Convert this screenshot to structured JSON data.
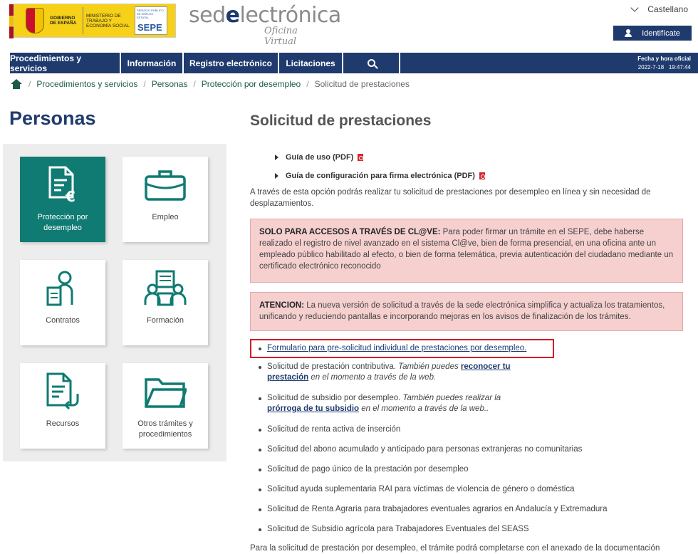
{
  "header": {
    "gov_label": "GOBIERNO DE ESPAÑA",
    "ministry_label": "MINISTERIO DE TRABAJO Y ECONOMÍA SOCIAL",
    "sepe_small": "SERVICIO PÚBLICO DE EMPLEO ESTATAL",
    "sepe_big": "SEPE",
    "sede_prefix": "sed",
    "sede_e": "e",
    "sede_suffix": "lectrónica",
    "sede_sub": "Oficina Virtual",
    "language": "Castellano",
    "login_label": "Identifícate"
  },
  "nav": {
    "items": [
      "Procedimientos y servicios",
      "Información",
      "Registro electrónico",
      "Licitaciones"
    ],
    "datetime_label": "Fecha y hora oficial",
    "date": "2022-7-18",
    "time": "19:47:44"
  },
  "breadcrumb": {
    "items": [
      "Procedimientos y servicios",
      "Personas",
      "Protección por desempleo"
    ],
    "current": "Solicitud de prestaciones"
  },
  "left": {
    "title": "Personas",
    "tiles": [
      {
        "label": "Protección por desempleo",
        "icon": "document-euro-icon",
        "active": true
      },
      {
        "label": "Empleo",
        "icon": "briefcase-icon",
        "active": false
      },
      {
        "label": "Contratos",
        "icon": "person-document-icon",
        "active": false
      },
      {
        "label": "Formación",
        "icon": "training-icon",
        "active": false
      },
      {
        "label": "Recursos",
        "icon": "document-return-icon",
        "active": false
      },
      {
        "label": "Otros trámites y procedimientos",
        "icon": "folder-icon",
        "active": false
      }
    ]
  },
  "main": {
    "title": "Solicitud de prestaciones",
    "pdf_links": [
      "Guía de uso (PDF)",
      "Guía de configuración para firma electrónica (PDF)"
    ],
    "intro": "A través de esta opción podrás realizar tu solicitud de prestaciones por desempleo en línea y sin necesidad de desplazamientos.",
    "alert1_bold": "SOLO PARA ACCESOS A TRAVÉS DE CL@VE:",
    "alert1_text": " Para poder firmar un trámite en el SEPE, debe haberse realizado el registro de nivel avanzado en el sistema Cl@ve, bien de forma presencial, en una oficina ante un empleado público habilitado al efecto, o bien de forma telemática, previa autenticación del ciudadano mediante un certificado electrónico reconocido",
    "alert2_bold": "ATENCION:",
    "alert2_text": " La nueva versión de solicitud a través de la sede electrónica simplifica y actualiza los tratamientos, unificando y reduciendo pantallas e incorporando mejoras en los avisos de finalización de los trámites.",
    "list": {
      "item0_link": "Formulario para pre-solicitud individual de prestaciones por desempleo.",
      "item1_text": "Solicitud de prestación contributiva. ",
      "item1_em": "También puedes ",
      "item1_link": "reconocer tu prestación",
      "item1_em2": " en el momento a través de la web.",
      "item2_text": "Solicitud de subsidio por desempleo. ",
      "item2_em": "También puedes realizar la ",
      "item2_link": "prórroga de tu subsidio",
      "item2_em2": " en el momento a través de la web..",
      "items_plain": [
        "Solicitud de renta activa de inserción",
        "Solicitud del abono acumulado y anticipado para personas extranjeras no comunitarias",
        "Solicitud de pago único de la prestación por desempleo",
        "Solicitud ayuda suplementaria RAI para víctimas de violencia de género o doméstica",
        "Solicitud de Renta Agraria para trabajadores eventuales agrarios en Andalucía y Extremadura",
        "Solicitud de Subsidio agrícola para Trabajadores Eventuales del SEASS"
      ]
    },
    "footer": "Para la solicitud de prestación por desempleo, el trámite podrá completarse con el anexado de la documentación"
  }
}
